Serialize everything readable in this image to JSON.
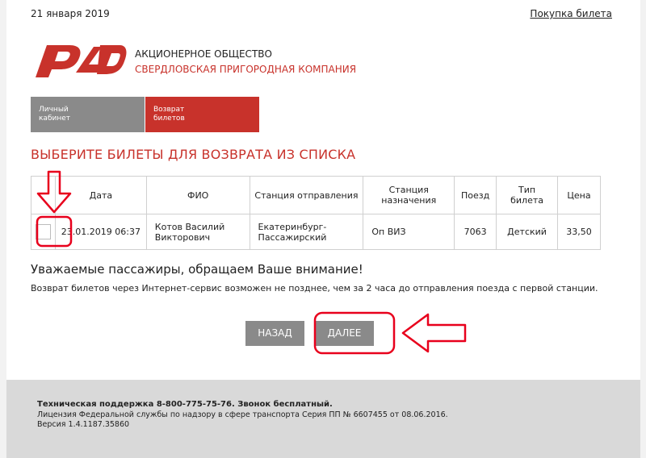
{
  "header": {
    "date": "21 января 2019",
    "buy_link": "Покупка билета",
    "company_line1": "АКЦИОНЕРНОЕ ОБЩЕСТВО",
    "company_line2": "СВЕРДЛОВСКАЯ ПРИГОРОДНАЯ КОМПАНИЯ"
  },
  "tabs": [
    {
      "line1": "Личный",
      "line2": "кабинет"
    },
    {
      "line1": "Возврат",
      "line2": "билетов"
    }
  ],
  "section_title": "ВЫБЕРИТЕ БИЛЕТЫ ДЛЯ ВОЗВРАТА ИЗ СПИСКА",
  "table": {
    "headers": {
      "date": "Дата",
      "name": "ФИО",
      "from": "Станция отправления",
      "to_line1": "Станция",
      "to_line2": "назначения",
      "train": "Поезд",
      "type_line1": "Тип",
      "type_line2": "билета",
      "price": "Цена"
    },
    "rows": [
      {
        "date": "23.01.2019 06:37",
        "name_line1": "Котов Василий",
        "name_line2": "Викторович",
        "from_line1": "Екатеринбург-",
        "from_line2": "Пассажирский",
        "to": "Оп ВИЗ",
        "train": "7063",
        "type": "Детский",
        "price": "33,50",
        "checked": false
      }
    ]
  },
  "notice": {
    "heading": "Уважаемые пассажиры, обращаем Ваше внимание!",
    "text": "Возврат билетов через Интернет-сервис возможен не позднее, чем за 2 часа до отправления поезда с первой станции."
  },
  "buttons": {
    "back": "НАЗАД",
    "next": "ДАЛЕЕ"
  },
  "footer": {
    "support": "Техническая поддержка 8-800-775-75-76. Звонок бесплатный.",
    "license": "Лицензия Федеральной службы по надзору в сфере транспорта Серия ПП № 6607455 от 08.06.2016.",
    "version": "Версия 1.4.1187.35860"
  },
  "colors": {
    "brand_red": "#c8322b",
    "button_gray": "#8a8a8a",
    "annotation_red": "#e8001c"
  },
  "icons": [
    "rzd-logo",
    "down-arrow-annotation-icon",
    "left-arrow-annotation-icon"
  ]
}
